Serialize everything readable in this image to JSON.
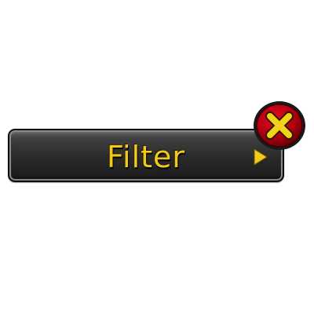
{
  "filter_button": {
    "label": "Filter",
    "arrow_icon": "triangle-right-icon",
    "label_color": "#f2c81a"
  },
  "close_badge": {
    "icon": "close-x-icon",
    "circle_color": "#b80010",
    "x_color": "#f2d21a"
  }
}
